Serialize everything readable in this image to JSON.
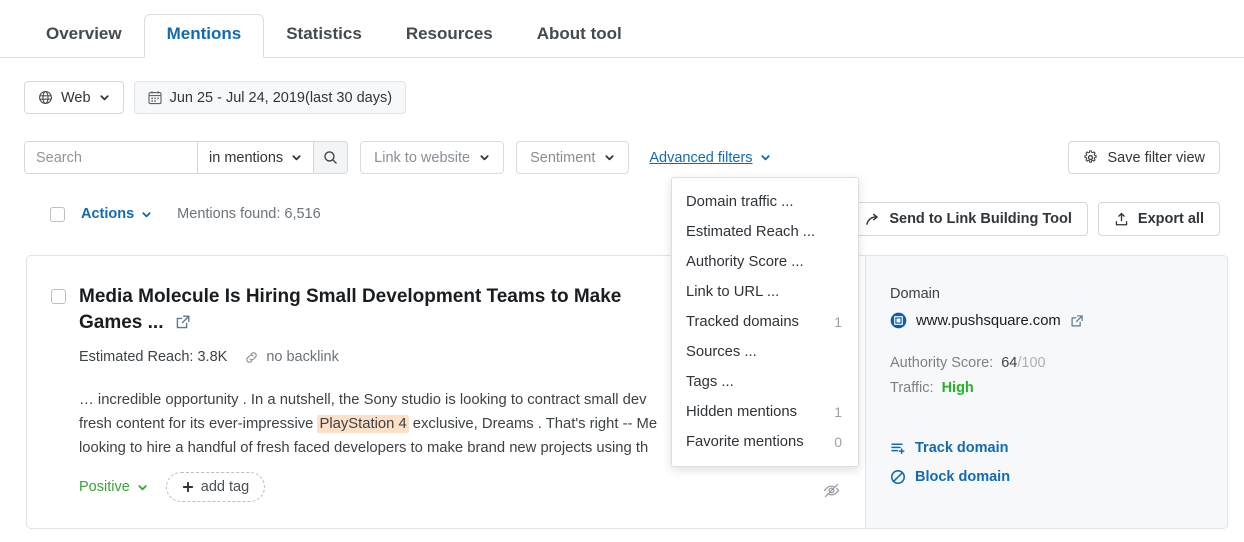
{
  "tabs": [
    {
      "label": "Overview",
      "active": false
    },
    {
      "label": "Mentions",
      "active": true
    },
    {
      "label": "Statistics",
      "active": false
    },
    {
      "label": "Resources",
      "active": false
    },
    {
      "label": "About tool",
      "active": false
    }
  ],
  "source_row": {
    "source_label": "Web",
    "date_range": "Jun 25 - Jul 24, 2019(last 30 days)"
  },
  "filters": {
    "search_placeholder": "Search",
    "search_value": "",
    "scope_label": "in mentions",
    "link_to_website_label": "Link to website",
    "sentiment_label": "Sentiment",
    "advanced_filters_label": "Advanced filters",
    "save_filter_label": "Save filter view"
  },
  "advanced_dropdown": {
    "items": [
      {
        "label": "Domain traffic ...",
        "count": ""
      },
      {
        "label": "Estimated Reach ...",
        "count": ""
      },
      {
        "label": "Authority Score ...",
        "count": ""
      },
      {
        "label": "Link to URL ...",
        "count": ""
      },
      {
        "label": "Tracked domains",
        "count": "1"
      },
      {
        "label": "Sources ...",
        "count": ""
      },
      {
        "label": "Tags ...",
        "count": ""
      },
      {
        "label": "Hidden mentions",
        "count": "1"
      },
      {
        "label": "Favorite mentions",
        "count": "0"
      }
    ]
  },
  "actions_row": {
    "actions_label": "Actions",
    "found_label": "Mentions found: 6,516",
    "send_to_link_building_label": "Send to Link Building Tool",
    "export_all_label": "Export all"
  },
  "mention": {
    "title": "Media Molecule Is Hiring Small Development Teams to Make Games ...",
    "estimated_reach": "Estimated Reach: 3.8K",
    "backlink_status": "no backlink",
    "snippet_lines": [
      {
        "pre": "… incredible opportunity . In a nutshell, the Sony studio is looking to contract small dev",
        "hl": "",
        "post": ""
      },
      {
        "pre": "fresh content for its ever-impressive ",
        "hl": "PlayStation 4",
        "post": " exclusive, Dreams . That's right -- Me"
      },
      {
        "pre": "looking to hire a handful of fresh faced developers to make brand new projects using th",
        "hl": "",
        "post": ""
      }
    ],
    "sentiment": "Positive",
    "add_tag_label": "add tag"
  },
  "domain_panel": {
    "heading": "Domain",
    "domain": "www.pushsquare.com",
    "authority_score_label": "Authority Score:",
    "authority_score_value": "64",
    "authority_score_max": "/100",
    "traffic_label": "Traffic:",
    "traffic_value": "High",
    "track_domain_label": "Track domain",
    "block_domain_label": "Block domain"
  },
  "colors": {
    "accent_blue": "#126bb2",
    "green": "#24b324",
    "highlight": "#fde0c6",
    "panel_bg": "#f7f8f9"
  }
}
